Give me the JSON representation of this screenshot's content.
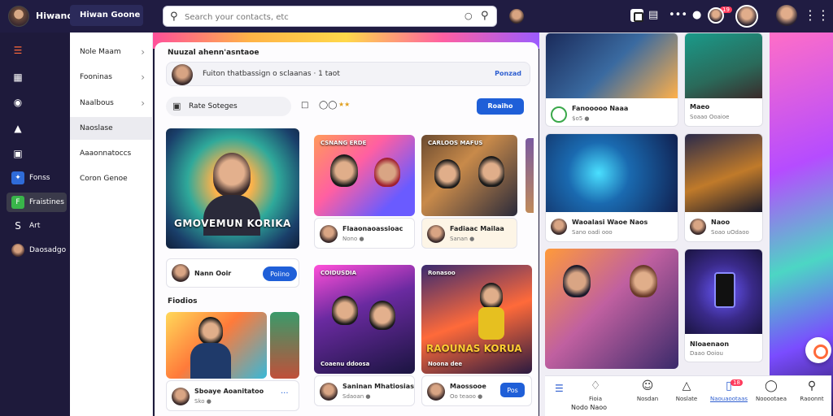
{
  "topbar": {
    "brand_name": "Hiwano",
    "brand_pill": "Hiwan Goone",
    "search_placeholder": "Search your contacts, etc"
  },
  "rail": [
    {
      "label": "",
      "icon": "grid-icon"
    },
    {
      "label": "",
      "icon": "news-icon"
    },
    {
      "label": "",
      "icon": "circle-icon"
    },
    {
      "label": "",
      "icon": "bell-icon"
    },
    {
      "label": "",
      "icon": "book-icon"
    },
    {
      "label": "Fonss",
      "icon": "blue-square-icon"
    },
    {
      "label": "Fraistines",
      "icon": "green-square-icon"
    },
    {
      "label": "Art",
      "icon": "s-icon"
    },
    {
      "label": "Daosadgo",
      "icon": "avatar-icon"
    }
  ],
  "menu": [
    {
      "label": "Nole Maam",
      "chevron": "›"
    },
    {
      "label": "Fooninas",
      "chevron": "›"
    },
    {
      "label": "Naalbous",
      "chevron": "›"
    },
    {
      "label": "Naoslase",
      "chevron": ""
    },
    {
      "label": "Aaaonnatoccs",
      "chevron": ""
    },
    {
      "label": "Coron Genoe",
      "chevron": ""
    }
  ],
  "feed": {
    "title": "Nuuzal ahenn'asntaoe",
    "composer_text": "Fuiton thatbassign o sclaanas · 1 taot",
    "composer_action": "Ponzad",
    "filter_text": "Rate Soteges",
    "new_button": "Roaiho",
    "hero_caption": "GMOVEMUN KORIKA",
    "follow_name": "Nann Ooir",
    "follow_button": "Poiino",
    "section_label": "Fiodios",
    "tile_a_title": "CSNANG ERDE",
    "tile_a_name": "Flaaonaoassioac",
    "tile_a_meta": "Nono ●",
    "tile_b_title": "CARLOOS MAFUS",
    "tile_b_name": "Fadiaac Mailaa",
    "tile_b_meta": "Sanan ●",
    "tile_c_title": "COIDUSDIA",
    "tile_c_bottom": "Coaenu ddoosa",
    "tile_c_name": "Saninan Mhatiosias",
    "tile_c_meta": "Sdaoan ●",
    "tile_d_title": "Ronasoo",
    "tile_d_caption": "RAOUNAS KORUA",
    "tile_d_bottom": "Noona dee",
    "tile_d_name": "Maossooe",
    "tile_d_meta": "Oo teaoo ●",
    "tile_d_button": "Pos",
    "tile_e_name": "Sboaye Aoanitatoo",
    "tile_e_meta": "Sko ●",
    "tile_e_more": "···"
  },
  "right_cards": {
    "r1_title": "Fanooooo Naaa",
    "r1_meta": "$o5 ●",
    "r2_title": "Maeo",
    "r2_meta": "Soaao Ooaioe",
    "r3_title": "Waoalasi Waoe Naos",
    "r3_meta": "Sano oadi ooo",
    "r4_title": "Naoo",
    "r4_meta": "Soao uOdaoo",
    "r5_title": "Nloaenaon",
    "r5_meta": "Daao Ooiou"
  },
  "bottom_nav": [
    {
      "label": "Fioia",
      "icon": "comment-icon"
    },
    {
      "label": "Nosdan",
      "icon": "smile-icon"
    },
    {
      "label": "Noslate",
      "icon": "triangle-icon"
    },
    {
      "label": "Naouaootaas",
      "icon": "phone-icon",
      "active": true
    },
    {
      "label": "Nooootaea",
      "icon": "people-icon"
    },
    {
      "label": "Raoonnt",
      "icon": "pin-icon"
    }
  ],
  "bottom_nav_left": "Nodo Naoo",
  "bottom_badge": "18",
  "top_badge": "19",
  "colors": {
    "topbar": "#201c42",
    "accent_blue": "#1f5fd8",
    "notification_red": "#ff3b5c"
  }
}
